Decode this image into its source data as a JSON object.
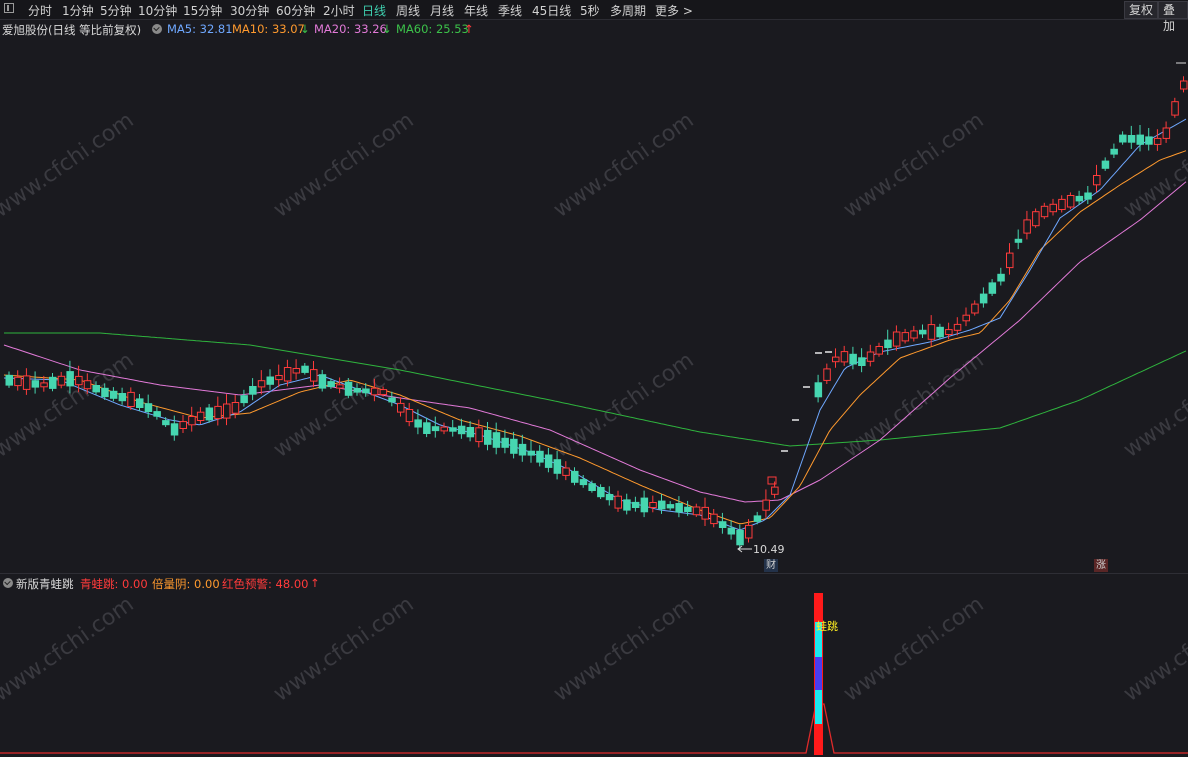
{
  "toolbar": {
    "items": [
      "分时",
      "1分钟",
      "5分钟",
      "10分钟",
      "15分钟",
      "30分钟",
      "60分钟",
      "2小时",
      "日线",
      "周线",
      "月线",
      "年线",
      "季线",
      "45日线",
      "5秒",
      "多周期",
      "更多 >"
    ],
    "active": "日线",
    "right_buttons": [
      "复权",
      "叠加"
    ]
  },
  "main_info": {
    "stock": "爱旭股份(日线 等比前复权)",
    "ma5_label": "MA5: 32.81",
    "ma10_label": "MA10: 33.07",
    "ma20_label": "MA20: 33.26",
    "ma60_label": "MA60: 25.53",
    "ma10_arrow": "↓",
    "ma20_arrow": "↓",
    "ma60_arrow": "↑",
    "colors": {
      "ma5": "#6fa8ff",
      "ma10": "#ff9a2e",
      "ma20": "#e27ad8",
      "ma60": "#3cc24a",
      "up": "#ff3b3b",
      "down": "#46d6b0"
    }
  },
  "chart_annotations": {
    "low_label": "10.49",
    "cai_badge": "财",
    "zhang_badge": "涨"
  },
  "sub_info": {
    "indicator": "新版青蛙跳",
    "qwt_label": "青蛙跳: 0.00",
    "bly_label": "倍量阴: 0.00",
    "hsyj_label": "红色预警: 48.00",
    "hsyj_arrow": "↑",
    "signal_text": "蛙跳"
  },
  "watermark": "www.cfchi.com"
}
